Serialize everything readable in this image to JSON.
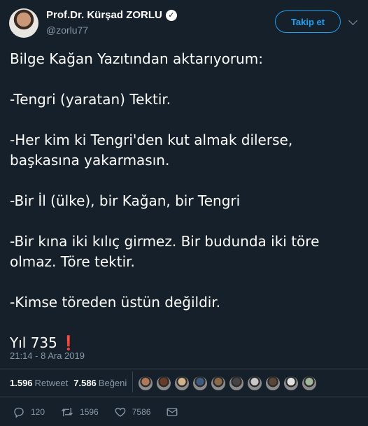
{
  "user": {
    "name": "Prof.Dr. Kürşad ZORLU",
    "handle": "@zorlu77",
    "verified_glyph": "✓",
    "follow_label": "Takip et"
  },
  "tweet": {
    "lines": [
      "Bilge Kağan Yazıtından aktarıyorum:",
      "",
      "-Tengri (yaratan) Tektir.",
      "",
      "-Her kim ki Tengri'den kut almak dilerse,",
      "başkasına yakarmasın.",
      "",
      "-Bir İl (ülke), bir Kağan, bir Tengri",
      "",
      "-Bir kına iki kılıç girmez. Bir budunda iki töre",
      "olmaz. Töre tektir.",
      "",
      "-Kimse töreden üstün değildir.",
      ""
    ],
    "final_line": "Yıl 735",
    "final_mark": "❗",
    "timestamp": "21:14 - 8 Ara 2019"
  },
  "stats": {
    "retweets": "1.596",
    "retweets_label": "Retweet",
    "likes": "7.586",
    "likes_label": "Beğeni"
  },
  "likers": [
    {
      "icon": "avatar",
      "color": "#b07a5a"
    },
    {
      "icon": "avatar",
      "color": "#6b3b2a"
    },
    {
      "icon": "avatar",
      "color": "#d2b48c"
    },
    {
      "icon": "avatar",
      "color": "#3d5a80"
    },
    {
      "icon": "avatar",
      "color": "#8a6a4a"
    },
    {
      "icon": "avatar",
      "color": "#444444"
    },
    {
      "icon": "avatar",
      "color": "#c9c9c9"
    },
    {
      "icon": "avatar",
      "color": "#5a4636"
    },
    {
      "icon": "avatar",
      "color": "#e2e2e2"
    },
    {
      "icon": "avatar",
      "color": "#9fb89a"
    }
  ],
  "actions": {
    "replies": "120",
    "retweets": "1596",
    "likes": "7586"
  },
  "colors": {
    "background": "#15202b",
    "accent": "#1da1f2",
    "muted": "#8899a6",
    "divider": "#38444d"
  }
}
